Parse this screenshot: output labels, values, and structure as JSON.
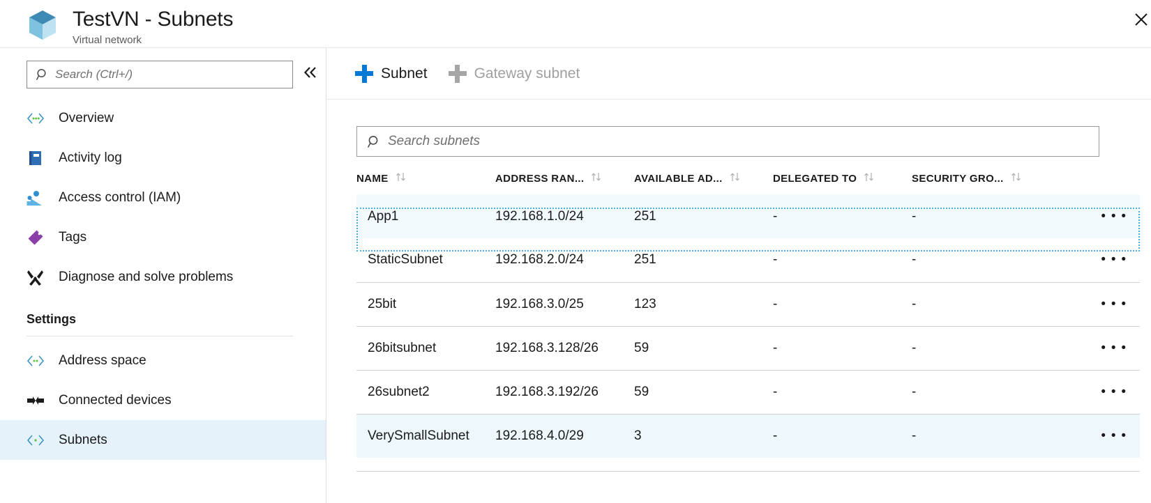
{
  "header": {
    "title": "TestVN - Subnets",
    "subtitle": "Virtual network",
    "resource_icon": "virtual-network-cube-icon",
    "close_icon": "close-icon"
  },
  "sidebar": {
    "search": {
      "placeholder": "Search (Ctrl+/)",
      "value": "",
      "icon": "search-icon"
    },
    "collapse_icon": "chevron-double-left-icon",
    "items": [
      {
        "label": "Overview",
        "icon": "vnet-brackets-icon",
        "active": false
      },
      {
        "label": "Activity log",
        "icon": "activity-log-book-icon",
        "active": false
      },
      {
        "label": "Access control (IAM)",
        "icon": "access-control-people-icon",
        "active": false
      },
      {
        "label": "Tags",
        "icon": "tag-icon",
        "active": false
      },
      {
        "label": "Diagnose and solve problems",
        "icon": "wrench-screwdriver-icon",
        "active": false
      }
    ],
    "settings_header": "Settings",
    "settings_items": [
      {
        "label": "Address space",
        "icon": "vnet-brackets-icon",
        "active": false
      },
      {
        "label": "Connected devices",
        "icon": "connected-devices-icon",
        "active": false
      },
      {
        "label": "Subnets",
        "icon": "vnet-brackets-icon",
        "active": true
      }
    ]
  },
  "toolbar": {
    "add_subnet_label": "Subnet",
    "add_gateway_subnet_label": "Gateway subnet",
    "accent_color": "#0078d4",
    "disabled_color": "#a6a6a6"
  },
  "grid": {
    "search": {
      "placeholder": "Search subnets",
      "value": "",
      "icon": "search-icon"
    },
    "columns": [
      {
        "label": "NAME",
        "sortable": true
      },
      {
        "label": "ADDRESS RAN...",
        "sortable": true
      },
      {
        "label": "AVAILABLE AD...",
        "sortable": true
      },
      {
        "label": "DELEGATED TO",
        "sortable": true
      },
      {
        "label": "SECURITY GRO...",
        "sortable": true
      },
      {
        "label": "",
        "sortable": false
      }
    ],
    "rows": [
      {
        "name": "App1",
        "address_range": "192.168.1.0/24",
        "available_addresses": "251",
        "delegated_to": "-",
        "security_group": "-",
        "menu": "• • •",
        "state": "focused"
      },
      {
        "name": "StaticSubnet",
        "address_range": "192.168.2.0/24",
        "available_addresses": "251",
        "delegated_to": "-",
        "security_group": "-",
        "menu": "• • •",
        "state": "normal"
      },
      {
        "name": "25bit",
        "address_range": "192.168.3.0/25",
        "available_addresses": "123",
        "delegated_to": "-",
        "security_group": "-",
        "menu": "• • •",
        "state": "normal"
      },
      {
        "name": "26bitsubnet",
        "address_range": "192.168.3.128/26",
        "available_addresses": "59",
        "delegated_to": "-",
        "security_group": "-",
        "menu": "• • •",
        "state": "normal"
      },
      {
        "name": "26subnet2",
        "address_range": "192.168.3.192/26",
        "available_addresses": "59",
        "delegated_to": "-",
        "security_group": "-",
        "menu": "• • •",
        "state": "normal"
      },
      {
        "name": "VerySmallSubnet",
        "address_range": "192.168.4.0/29",
        "available_addresses": "3",
        "delegated_to": "-",
        "security_group": "-",
        "menu": "• • •",
        "state": "hovered"
      }
    ]
  },
  "colors": {
    "accent": "#0078d4",
    "nav_active_bg": "#e5f2fa",
    "row_focus_bg": "#f2fafd",
    "row_hover_bg": "#eef7fb",
    "focus_outline": "#4aaee3"
  }
}
